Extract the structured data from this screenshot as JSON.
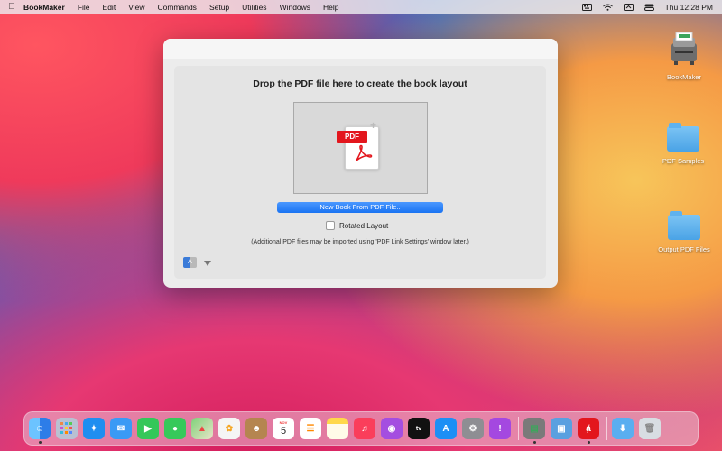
{
  "menubar": {
    "app_name": "BookMaker",
    "items": [
      "File",
      "Edit",
      "View",
      "Commands",
      "Setup",
      "Utilities",
      "Windows",
      "Help"
    ],
    "clock": "Thu 12:28 PM",
    "status_icons": [
      "keyboard-icon",
      "wifi-icon",
      "display-icon",
      "control-center-icon"
    ]
  },
  "desktop": {
    "icons": [
      {
        "label": "BookMaker",
        "icon": "bookmaker-app-icon"
      },
      {
        "label": "PDF Samples",
        "icon": "folder-icon"
      },
      {
        "label": "Output PDF Files",
        "icon": "folder-icon"
      }
    ]
  },
  "window": {
    "drop_title": "Drop the PDF file here to create the book layout",
    "pdf_badge": "PDF",
    "new_book_button": "New Book From PDF File..",
    "rotated_label": "Rotated Layout",
    "rotated_checked": false,
    "note": "(Additional PDF files may be imported using 'PDF Link Settings' window later.)",
    "lang_glyph": "A"
  },
  "dock": {
    "items": [
      {
        "name": "finder",
        "color": "#2f8df0",
        "running": true
      },
      {
        "name": "launchpad",
        "color": "#9aa4b8",
        "running": false
      },
      {
        "name": "safari",
        "color": "#1f8ef0",
        "running": false
      },
      {
        "name": "mail",
        "color": "#3a9af5",
        "running": false
      },
      {
        "name": "facetime",
        "color": "#34c759",
        "running": false
      },
      {
        "name": "messages",
        "color": "#36c95a",
        "running": false
      },
      {
        "name": "maps",
        "color": "#6cc46a",
        "running": false
      },
      {
        "name": "photos",
        "color": "#f5f5f5",
        "running": false
      },
      {
        "name": "contacts",
        "color": "#b58550",
        "running": false
      },
      {
        "name": "calendar",
        "color": "#ffffff",
        "running": false
      },
      {
        "name": "reminders",
        "color": "#ffffff",
        "running": false
      },
      {
        "name": "notes",
        "color": "#ffd84a",
        "running": false
      },
      {
        "name": "music",
        "color": "#fa3e5b",
        "running": false
      },
      {
        "name": "podcasts",
        "color": "#a44ee0",
        "running": false
      },
      {
        "name": "tv",
        "color": "#111111",
        "running": false
      },
      {
        "name": "app-store",
        "color": "#1d8ff5",
        "running": false
      },
      {
        "name": "system-preferences",
        "color": "#8e8e93",
        "running": false
      },
      {
        "name": "feedback",
        "color": "#a448e0",
        "running": false
      }
    ],
    "right_items": [
      {
        "name": "bookmaker",
        "color": "#7a7a7a",
        "running": true
      },
      {
        "name": "preview",
        "color": "#5aa0e0",
        "running": false
      },
      {
        "name": "acrobat",
        "color": "#e3161d",
        "running": true
      }
    ],
    "extra_items": [
      {
        "name": "downloads",
        "color": "#5aaef0",
        "running": false
      },
      {
        "name": "trash",
        "color": "#d8dde2",
        "running": false
      }
    ],
    "calendar_month": "NOV",
    "calendar_day": "5"
  }
}
